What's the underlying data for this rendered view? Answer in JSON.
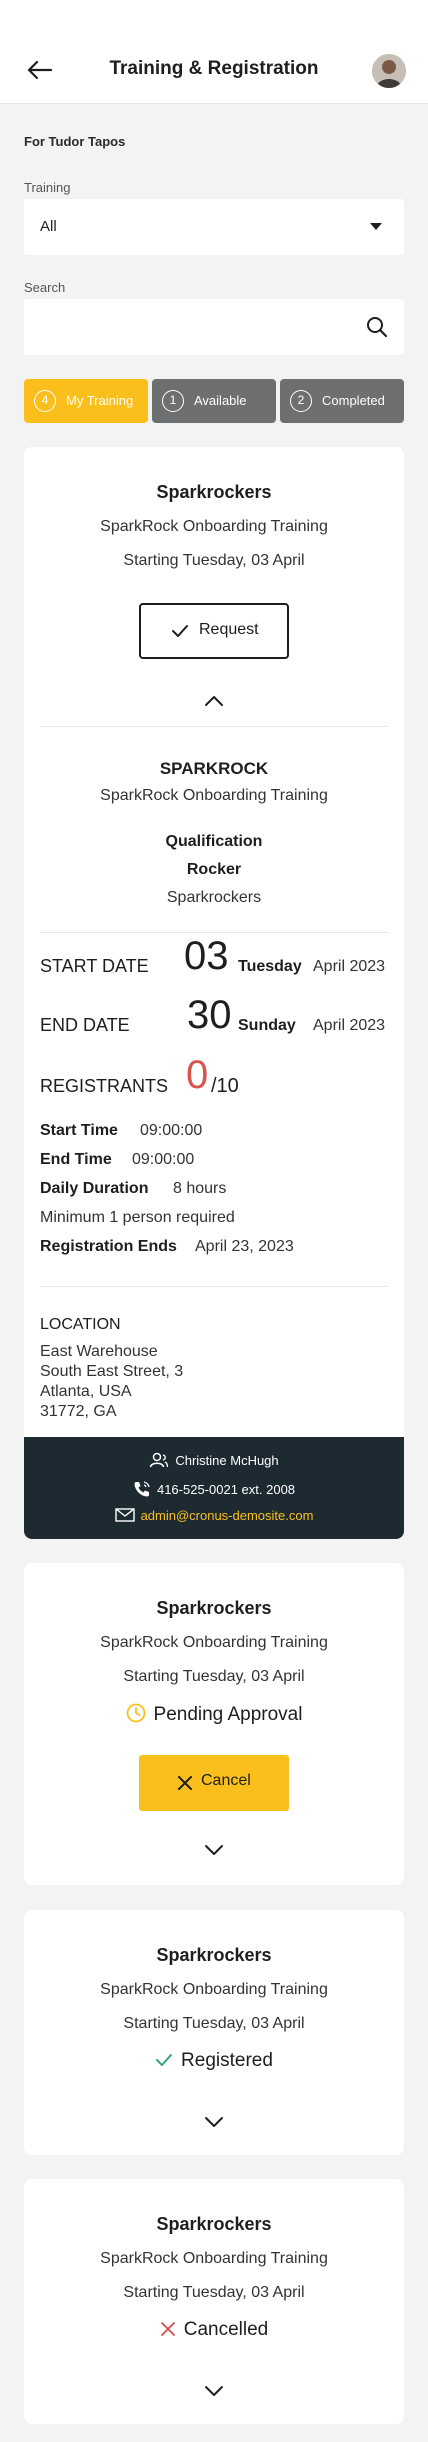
{
  "header": {
    "title": "Training & Registration"
  },
  "filters": {
    "for_user": "For Tudor Tapos",
    "training_label": "Training",
    "training_value": "All",
    "search_label": "Search",
    "search_placeholder": ""
  },
  "tabs": [
    {
      "count": "4",
      "label": "My Training",
      "active": true
    },
    {
      "count": "1",
      "label": "Available",
      "active": false
    },
    {
      "count": "2",
      "label": "Completed",
      "active": false
    }
  ],
  "cards": [
    {
      "title": "Sparkrockers",
      "course": "SparkRock Onboarding Training",
      "starting": "Starting Tuesday, 03 April",
      "action_label": "Request",
      "details": {
        "org": "SPARKROCK",
        "course": "SparkRock Onboarding Training",
        "qualification_label": "Qualification",
        "qualification_value": "Rocker",
        "qualification_org": "Sparkrockers",
        "start_label": "START DATE",
        "start_day": "03",
        "start_weekday": "Tuesday",
        "start_month": "April 2023",
        "end_label": "END DATE",
        "end_day": "30",
        "end_weekday": "Sunday",
        "end_month": "April 2023",
        "registrants_label": "REGISTRANTS",
        "registrants_count": "0",
        "registrants_max": "/10",
        "start_time_label": "Start Time",
        "start_time": "09:00:00",
        "end_time_label": "End Time",
        "end_time": "09:00:00",
        "duration_label": "Daily Duration",
        "duration": "8 hours",
        "minimum": "Minimum 1 person required",
        "reg_ends_label": "Registration Ends",
        "reg_ends": "April 23, 2023",
        "location_label": "LOCATION",
        "location_lines": [
          "East Warehouse",
          "South East Street, 3",
          "Atlanta, USA",
          "31772, GA"
        ],
        "contact_name": "Christine McHugh",
        "contact_phone": "416-525-0021 ext. 2008",
        "contact_email": "admin@cronus-demosite.com"
      }
    },
    {
      "title": "Sparkrockers",
      "course": "SparkRock Onboarding Training",
      "starting": "Starting Tuesday, 03 April",
      "status": "Pending Approval",
      "action_label": "Cancel"
    },
    {
      "title": "Sparkrockers",
      "course": "SparkRock Onboarding Training",
      "starting": "Starting Tuesday, 03 April",
      "status": "Registered"
    },
    {
      "title": "Sparkrockers",
      "course": "SparkRock Onboarding Training",
      "starting": "Starting Tuesday, 03 April",
      "status": "Cancelled"
    }
  ],
  "colors": {
    "accent_yellow": "#fbbf1c",
    "tab_gray": "#6d6f70",
    "registrants_red": "#d9534f",
    "contact_bar": "#1d2a32",
    "registered_green": "#3aa17e",
    "cancelled_red": "#d94c4c"
  },
  "icons": [
    "back-arrow-icon",
    "chevron-down-icon",
    "search-icon",
    "check-icon",
    "chevron-up-icon",
    "person-icon",
    "phone-icon",
    "mail-icon",
    "clock-icon",
    "close-icon"
  ]
}
